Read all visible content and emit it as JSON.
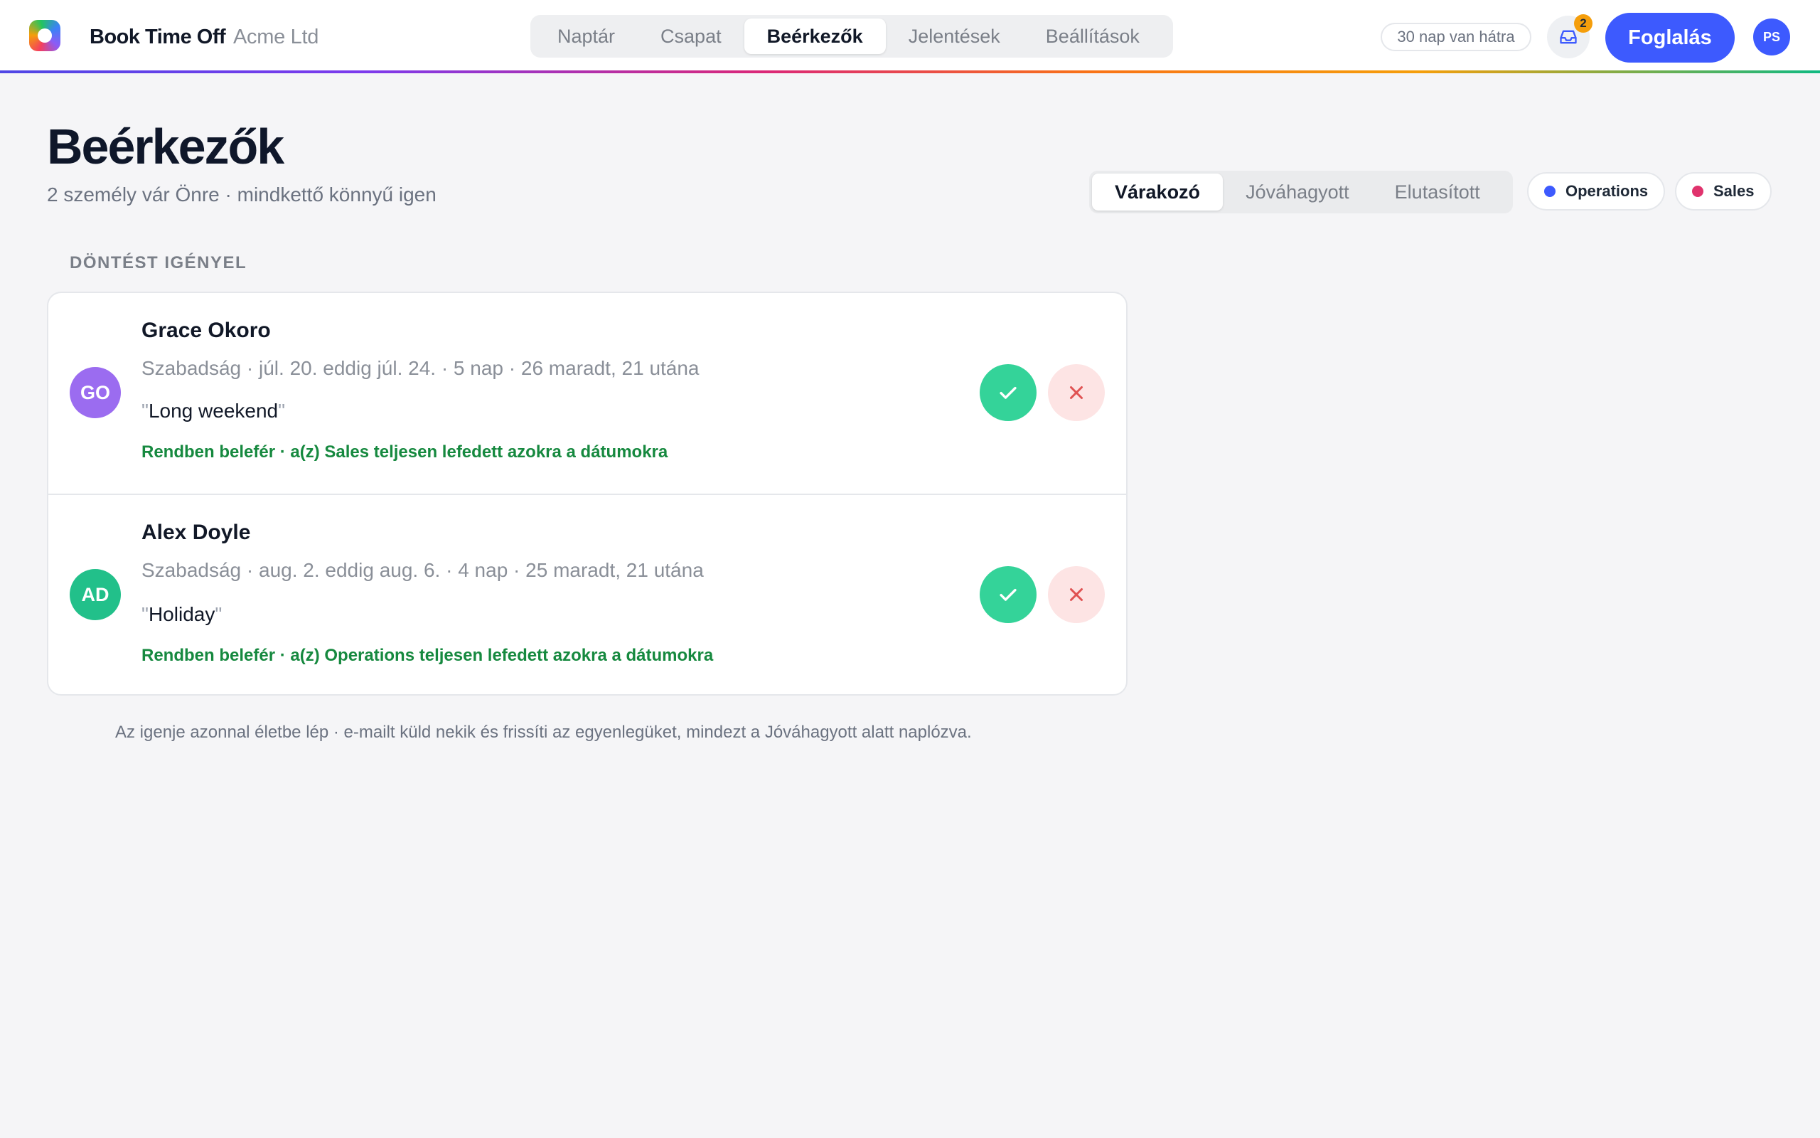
{
  "app": {
    "name": "Book Time Off",
    "org": "Acme Ltd"
  },
  "nav": {
    "tabs": [
      {
        "label": "Naptár"
      },
      {
        "label": "Csapat"
      },
      {
        "label": "Beérkezők"
      },
      {
        "label": "Jelentések"
      },
      {
        "label": "Beállítások"
      }
    ],
    "active": "Beérkezők"
  },
  "header": {
    "days_left": "30 nap van hátra",
    "inbox_count": "2",
    "book_label": "Foglalás",
    "user_initials": "PS"
  },
  "page": {
    "title": "Beérkezők",
    "subtitle": "2 személy vár Önre · mindkettő könnyű igen",
    "section_label": "DÖNTÉST IGÉNYEL",
    "footer_note": "Az igenje azonnal életbe lép · e-mailt küld nekik és frissíti az egyenlegüket, mindezt a Jóváhagyott alatt naplózva."
  },
  "status_tabs": [
    {
      "label": "Várakozó"
    },
    {
      "label": "Jóváhagyott"
    },
    {
      "label": "Elutasított"
    }
  ],
  "filters": [
    {
      "label": "Operations",
      "color": "#3d5afe"
    },
    {
      "label": "Sales",
      "color": "#e0336d"
    }
  ],
  "requests": [
    {
      "initials": "GO",
      "avatar_color": "#9b6cf0",
      "name": "Grace Okoro",
      "meta": "Szabadság · júl. 20. eddig júl. 24. · 5 nap · 26 maradt, 21 utána",
      "note": "Long weekend",
      "status": "Rendben belefér · a(z) Sales teljesen lefedett azokra a dátumokra"
    },
    {
      "initials": "AD",
      "avatar_color": "#22c08a",
      "name": "Alex Doyle",
      "meta": "Szabadság · aug. 2. eddig aug. 6. · 4 nap · 25 maradt, 21 utána",
      "note": "Holiday",
      "status": "Rendben belefér · a(z) Operations teljesen lefedett azokra a dátumokra"
    }
  ],
  "colors": {
    "accent": "#3d5afe",
    "approve": "#34d399",
    "reject_bg": "#fde4e4",
    "reject_icon": "#e05252",
    "success_text": "#16893f",
    "badge": "#f59e0b"
  }
}
